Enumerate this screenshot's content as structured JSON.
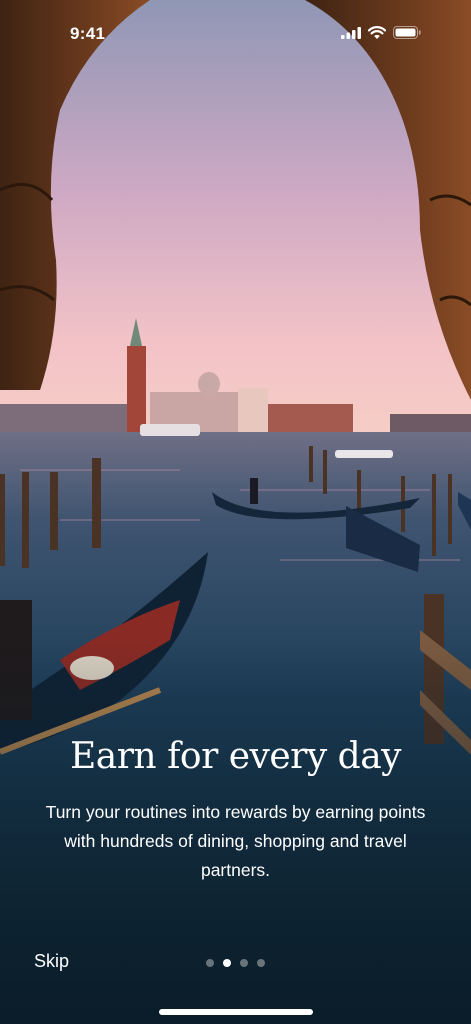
{
  "status_bar": {
    "time": "9:41",
    "icons": [
      "cellular-signal-icon",
      "wifi-icon",
      "battery-icon"
    ]
  },
  "onboarding": {
    "headline": "Earn for every day",
    "subtitle": "Turn your routines into rewards by earning points with hundreds of dining, shopping and travel partners.",
    "skip_label": "Skip",
    "pagination": {
      "total": 4,
      "current": 2
    }
  },
  "background": {
    "sky_top": "#8a95b3",
    "sky_horizon": "#f0c2c8",
    "water": "#12314a",
    "arch": "#5a2f18"
  }
}
